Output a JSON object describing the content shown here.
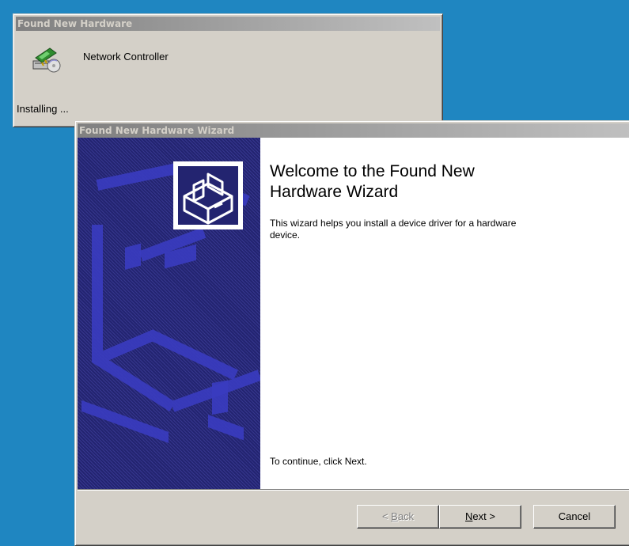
{
  "popup": {
    "title": "Found New Hardware",
    "device_name": "Network Controller",
    "status": "Installing ..."
  },
  "wizard": {
    "title": "Found New Hardware Wizard",
    "heading": "Welcome to the Found New Hardware Wizard",
    "description": "This wizard helps you install a device driver for a hardware device.",
    "continue_text": "To continue, click Next.",
    "buttons": {
      "back_prefix": "< ",
      "back_hotkey": "B",
      "back_rest": "ack",
      "next_hotkey": "N",
      "next_rest": "ext >",
      "cancel": "Cancel"
    }
  },
  "colors": {
    "desktop": "#1f86c1",
    "window_face": "#d4d0c8",
    "inactive_title_start": "#808080",
    "inactive_title_end": "#c0c0c0",
    "banner": "#232470"
  },
  "icons": {
    "popup_icon": "hardware-card-cd-icon",
    "wizard_icon": "hardware-box-icon"
  }
}
